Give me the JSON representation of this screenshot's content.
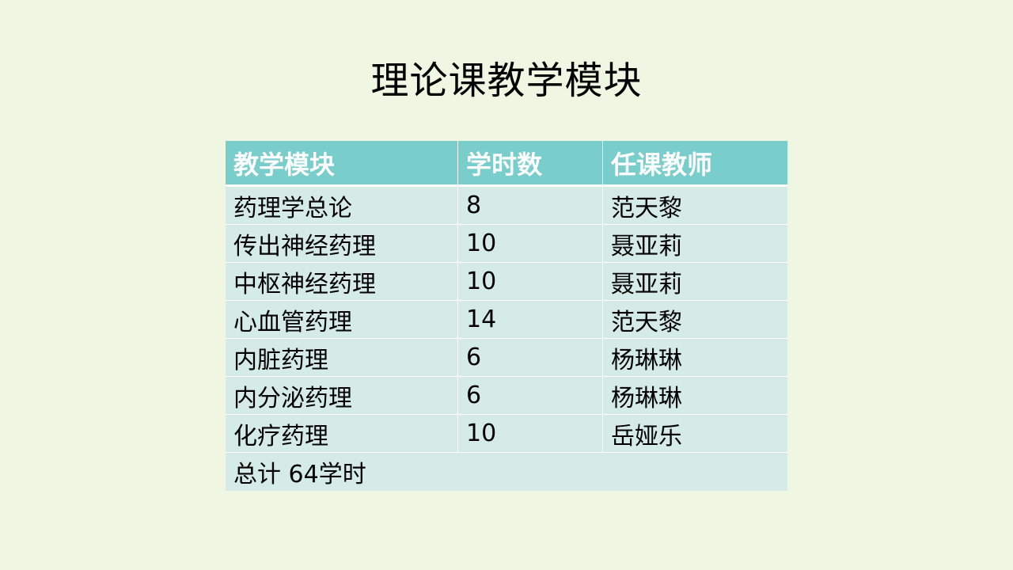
{
  "title": "理论课教学模块",
  "table": {
    "headers": [
      "教学模块",
      "学时数",
      "任课教师"
    ],
    "rows": [
      {
        "module": "药理学总论",
        "hours": "8",
        "teacher": "范天黎"
      },
      {
        "module": "传出神经药理",
        "hours": "10",
        "teacher": "聂亚莉"
      },
      {
        "module": "中枢神经药理",
        "hours": "10",
        "teacher": "聂亚莉"
      },
      {
        "module": "心血管药理",
        "hours": "14",
        "teacher": "范天黎"
      },
      {
        "module": "内脏药理",
        "hours": "6",
        "teacher": "杨琳琳"
      },
      {
        "module": "内分泌药理",
        "hours": "6",
        "teacher": "杨琳琳"
      },
      {
        "module": "化疗药理",
        "hours": "10",
        "teacher": "岳娅乐"
      }
    ],
    "total": "总计 64学时"
  },
  "colors": {
    "background": "#eff7e3",
    "header_fill": "#79cdcb",
    "cell_fill": "#d4ebe7"
  }
}
